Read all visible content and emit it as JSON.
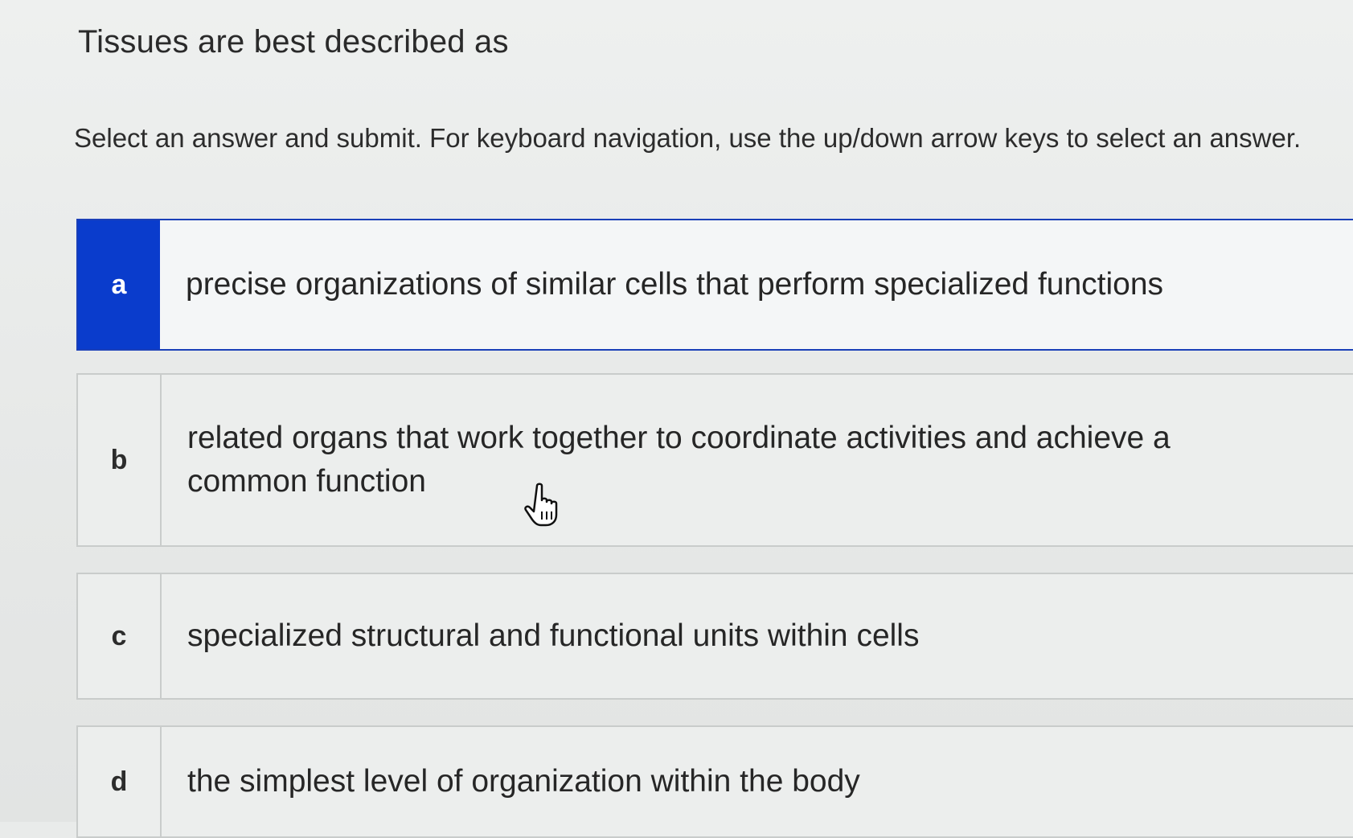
{
  "question": {
    "title": "Tissues are best described as",
    "instructions": "Select an answer and submit. For keyboard navigation, use the up/down arrow keys to select an answer."
  },
  "choices": [
    {
      "letter": "a",
      "text": "precise organizations of similar cells that perform specialized functions",
      "selected": true
    },
    {
      "letter": "b",
      "text": "related organs that work together to coordinate activities and achieve a common function",
      "selected": false
    },
    {
      "letter": "c",
      "text": "specialized structural and functional units within cells",
      "selected": false
    },
    {
      "letter": "d",
      "text": "the simplest level of organization within the body",
      "selected": false
    }
  ],
  "colors": {
    "selected_accent": "#0a3ccc",
    "border": "#c9cccb",
    "background": "#e9ebea"
  },
  "icons": {
    "cursor": "hand-pointer-icon"
  }
}
